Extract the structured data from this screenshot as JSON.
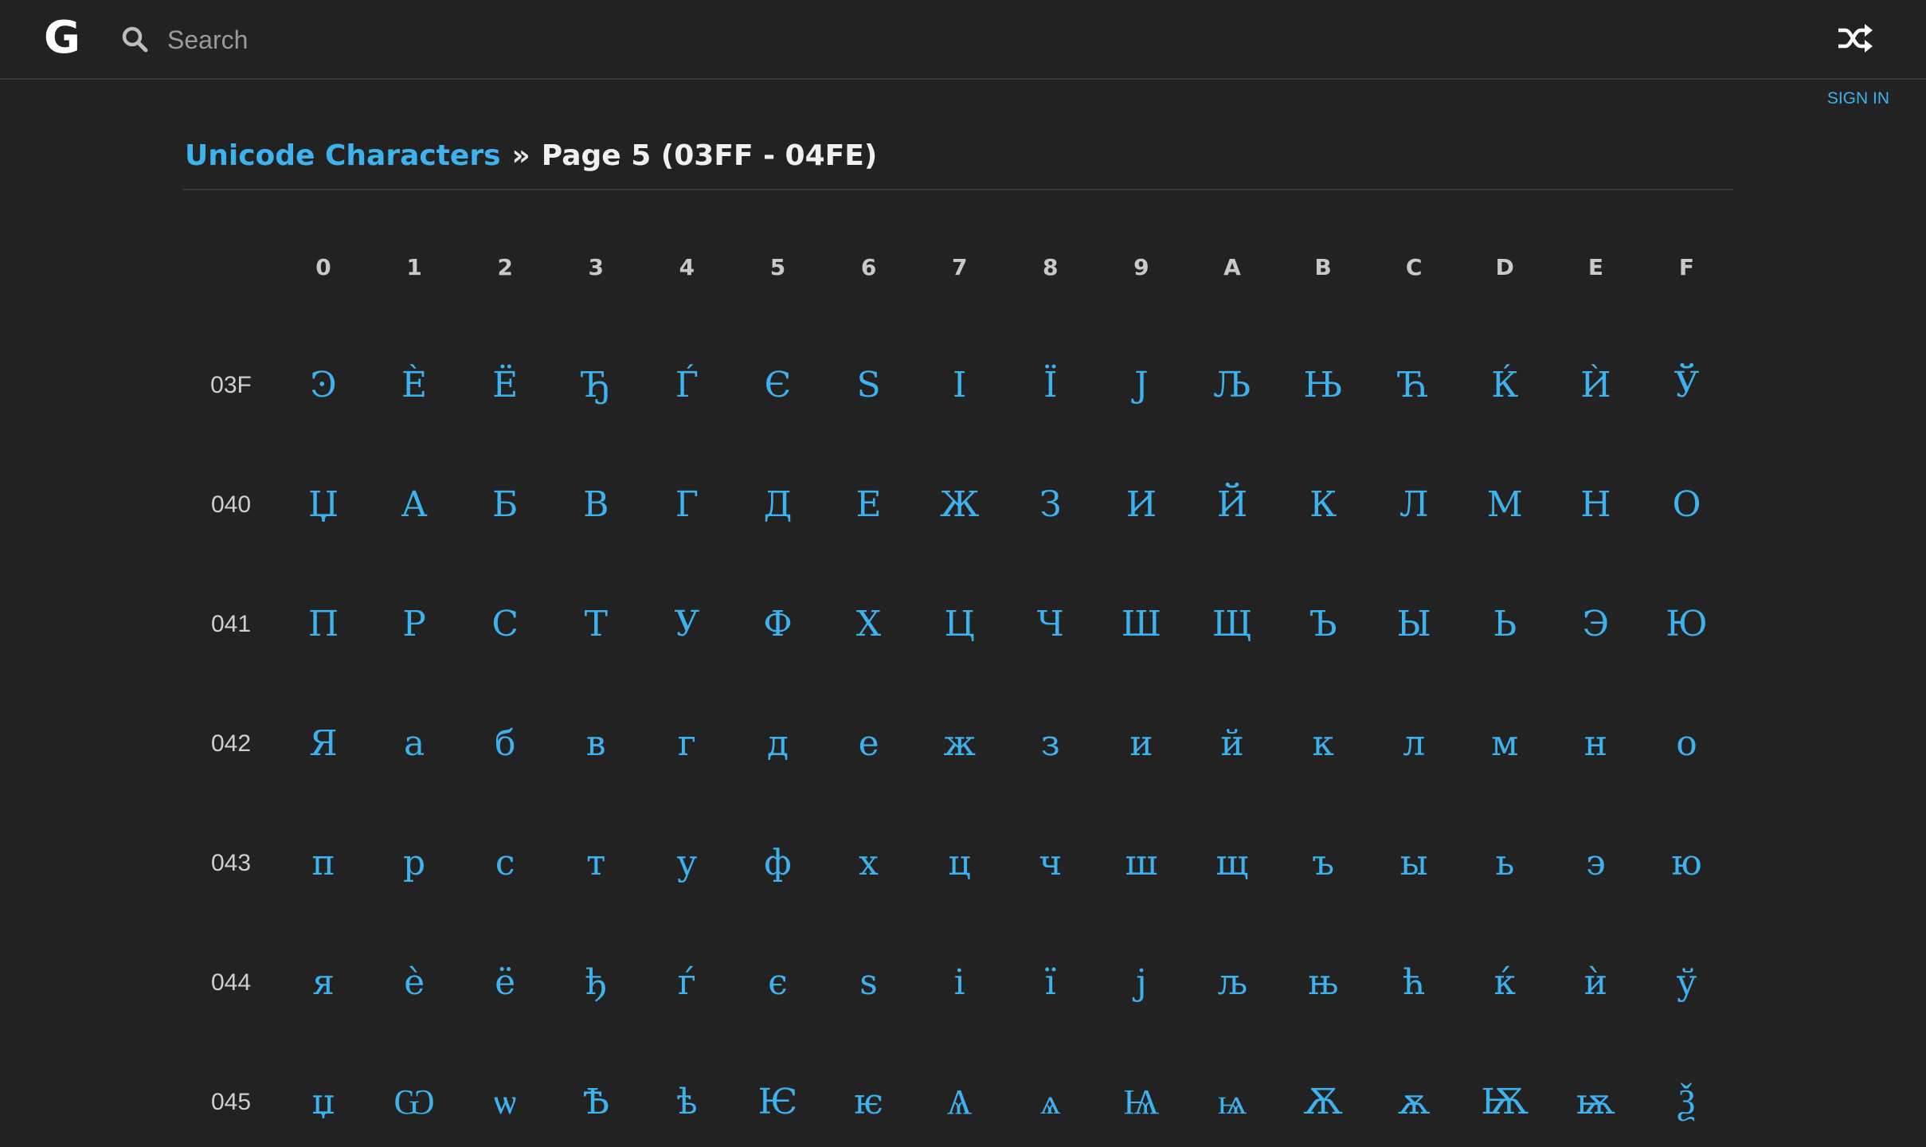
{
  "header": {
    "logo_text": "G",
    "search_placeholder": "Search",
    "sign_in_label": "SIGN IN",
    "logo_icon": "g-logo-icon",
    "search_icon": "search-icon",
    "random_icon": "shuffle-icon"
  },
  "breadcrumb": {
    "root_label": "Unicode Characters",
    "separator": "»",
    "current": "Page 5 (03FF - 04FE)"
  },
  "colors": {
    "background": "#222222",
    "accent": "#3db2ee"
  },
  "table": {
    "columns": [
      "0",
      "1",
      "2",
      "3",
      "4",
      "5",
      "6",
      "7",
      "8",
      "9",
      "A",
      "B",
      "C",
      "D",
      "E",
      "F"
    ],
    "rows": [
      {
        "label": "03F",
        "chars": [
          "Ͽ",
          "Ѐ",
          "Ё",
          "Ђ",
          "Ѓ",
          "Є",
          "Ѕ",
          "І",
          "Ї",
          "Ј",
          "Љ",
          "Њ",
          "Ћ",
          "Ќ",
          "Ѝ",
          "Ў"
        ]
      },
      {
        "label": "040",
        "chars": [
          "Џ",
          "А",
          "Б",
          "В",
          "Г",
          "Д",
          "Е",
          "Ж",
          "З",
          "И",
          "Й",
          "К",
          "Л",
          "М",
          "Н",
          "О"
        ]
      },
      {
        "label": "041",
        "chars": [
          "П",
          "Р",
          "С",
          "Т",
          "У",
          "Ф",
          "Х",
          "Ц",
          "Ч",
          "Ш",
          "Щ",
          "Ъ",
          "Ы",
          "Ь",
          "Э",
          "Ю"
        ]
      },
      {
        "label": "042",
        "chars": [
          "Я",
          "а",
          "б",
          "в",
          "г",
          "д",
          "е",
          "ж",
          "з",
          "и",
          "й",
          "к",
          "л",
          "м",
          "н",
          "о"
        ]
      },
      {
        "label": "043",
        "chars": [
          "п",
          "р",
          "с",
          "т",
          "у",
          "ф",
          "х",
          "ц",
          "ч",
          "ш",
          "щ",
          "ъ",
          "ы",
          "ь",
          "э",
          "ю"
        ]
      },
      {
        "label": "044",
        "chars": [
          "я",
          "ѐ",
          "ё",
          "ђ",
          "ѓ",
          "є",
          "ѕ",
          "і",
          "ї",
          "ј",
          "љ",
          "њ",
          "ћ",
          "ќ",
          "ѝ",
          "ў"
        ]
      },
      {
        "label": "045",
        "chars": [
          "џ",
          "Ѡ",
          "ѡ",
          "Ѣ",
          "ѣ",
          "Ѥ",
          "ѥ",
          "Ѧ",
          "ѧ",
          "Ѩ",
          "ѩ",
          "Ѫ",
          "ѫ",
          "Ѭ",
          "ѭ",
          "Ѯ"
        ]
      }
    ]
  }
}
